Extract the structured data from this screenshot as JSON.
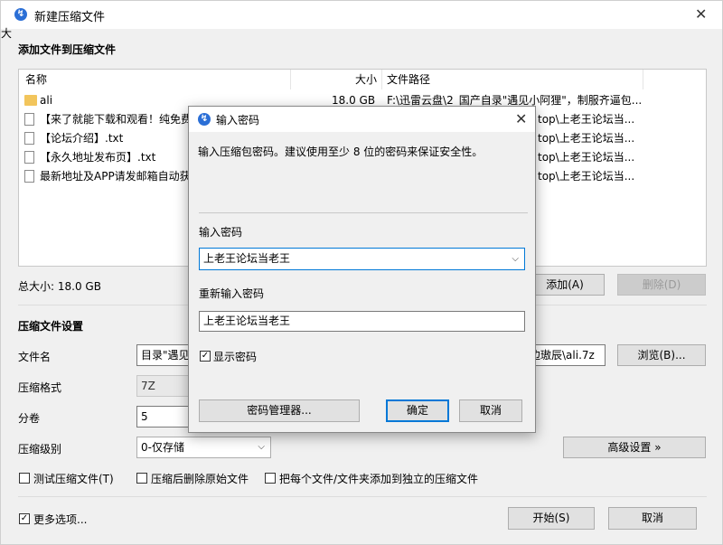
{
  "window": {
    "title": "新建压缩文件",
    "section_add": "添加文件到压缩文件",
    "columns": {
      "name": "名称",
      "size": "大小",
      "path": "文件路径"
    },
    "files": [
      {
        "icon": "folder-icon",
        "name": "ali",
        "size": "18.0 GB",
        "path": "F:\\迅雷云盘\\2_国产自录\"遇见小阿狸\"，制服齐逼包..."
      },
      {
        "icon": "file-icon",
        "name": "【来了就能下载和观看！纯免费",
        "size": "",
        "path": "top\\上老王论坛当..."
      },
      {
        "icon": "file-icon",
        "name": "【论坛介绍】.txt",
        "size": "",
        "path": "top\\上老王论坛当..."
      },
      {
        "icon": "file-icon",
        "name": "【永久地址发布页】.txt",
        "size": "",
        "path": "top\\上老王论坛当..."
      },
      {
        "icon": "file-icon",
        "name": "最新地址及APP请发邮箱自动获",
        "size": "",
        "path": "top\\上老王论坛当..."
      }
    ],
    "total_size": "总大小: 18.0 GB",
    "add_button": "添加(A)",
    "delete_button": "删除(D)",
    "section_settings": "压缩文件设置",
    "filename_label": "文件名",
    "filename_value": "目录\"遇见小",
    "filename_tail": "边璈辰\\ali.7z",
    "browse_button": "浏览(B)...",
    "format_label": "压缩格式",
    "format_value": "7Z",
    "volume_label": "分卷",
    "volume_value": "5",
    "level_label": "压缩级别",
    "level_value": "0-仅存储",
    "advanced_button": "高级设置 »",
    "test_label": "测试压缩文件(T)",
    "delete_after_label": "压缩后删除原始文件",
    "separate_label": "把每个文件/文件夹添加到独立的压缩文件",
    "more_options_label": "更多选项...",
    "start_button": "开始(S)",
    "cancel_button": "取消",
    "left_edge_char": "大"
  },
  "dialog": {
    "title": "输入密码",
    "info": "输入压缩包密码。建议使用至少 8 位的密码来保证安全性。",
    "password_label": "输入密码",
    "password_value": "上老王论坛当老王",
    "reenter_label": "重新输入密码",
    "reenter_value": "上老王论坛当老王",
    "show_password_label": "显示密码",
    "manager_button": "密码管理器...",
    "ok_button": "确定",
    "cancel_button": "取消"
  }
}
